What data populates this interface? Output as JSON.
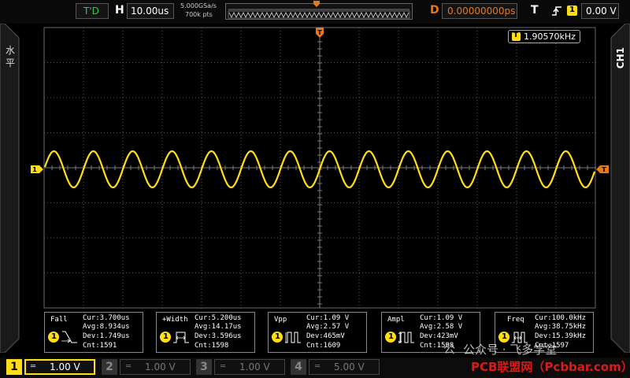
{
  "topbar": {
    "trigger_status": "T'D",
    "horizontal_label": "H",
    "timebase": "10.00us",
    "sample_rate": "5.000GSa/s",
    "memory_depth": "700k pts",
    "delay_label": "D",
    "delay_value": "0.00000000ps",
    "trigger_label": "T",
    "trigger_source": "1",
    "trigger_level": "0.00 V",
    "icons": {
      "slope": "rising-edge-icon",
      "memory_marker": "trigger-position-icon"
    }
  },
  "side": {
    "left_label": "水\n平",
    "right_label": "CH1"
  },
  "plot": {
    "freq_counter_icon": "T",
    "freq_counter": "1.90570kHz",
    "ch1_marker": "1",
    "trigger_marker": "T",
    "colors": {
      "trace": "#ffde17",
      "grid": "#5a5a5a",
      "trigger": "#e8781a"
    }
  },
  "measurements": [
    {
      "name": "Fall",
      "cur": "Cur:3.700us",
      "avg": "Avg:8.934us",
      "dev": "Dev:1.749us",
      "cnt": "Cnt:1591",
      "icon": "fall-time-icon"
    },
    {
      "name": "+Width",
      "cur": "Cur:5.200us",
      "avg": "Avg:14.17us",
      "dev": "Dev:3.596us",
      "cnt": "Cnt:1598",
      "icon": "positive-width-icon"
    },
    {
      "name": "Vpp",
      "cur": "Cur:1.09 V",
      "avg": "Avg:2.57 V",
      "dev": "Dev:465mV",
      "cnt": "Cnt:1609",
      "icon": "vpp-icon"
    },
    {
      "name": "Ampl",
      "cur": "Cur:1.09 V",
      "avg": "Avg:2.58 V",
      "dev": "Dev:423mV",
      "cnt": "Cnt:1598",
      "icon": "amplitude-icon"
    },
    {
      "name": "Freq",
      "cur": "Cur:100.0kHz",
      "avg": "Avg:38.75kHz",
      "dev": "Dev:15.39kHz",
      "cnt": "Cnt:1597",
      "icon": "frequency-icon"
    }
  ],
  "channels": [
    {
      "num": "1",
      "coupling": "═",
      "scale": "1.00 V",
      "active": true
    },
    {
      "num": "2",
      "coupling": "═",
      "scale": "1.00 V",
      "active": false
    },
    {
      "num": "3",
      "coupling": "═",
      "scale": "1.00 V",
      "active": false
    },
    {
      "num": "4",
      "coupling": "═",
      "scale": "5.00 V",
      "active": false
    }
  ],
  "watermark": {
    "logo": "公",
    "account": "公众号 · 飞多学堂",
    "site": "PCB联盟网（Pcbbar.com）"
  }
}
